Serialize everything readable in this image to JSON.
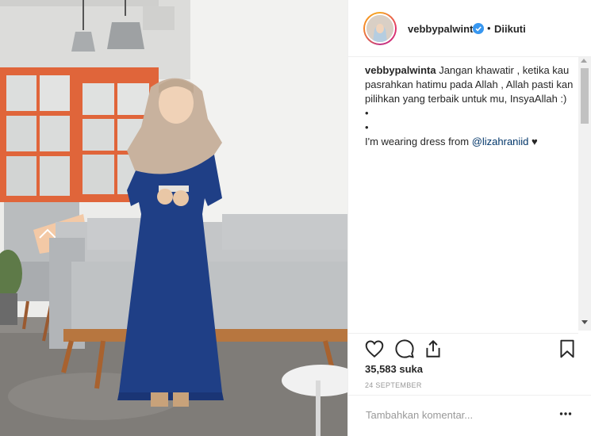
{
  "post": {
    "username": "vebbypalwinta",
    "verified": true,
    "follow_dot": "•",
    "follow_status": "Diikuti",
    "caption": {
      "username": "vebbypalwinta",
      "text": "Jangan khawatir , ketika kau pasrahkan hatimu pada Allah , Allah pasti kan pilihkan yang terbaik untuk mu, InsyaAllah :)",
      "dot1": "•",
      "dot2": "•",
      "wearing_prefix": "I'm wearing dress from ",
      "mention": "@lizahraniid",
      "heart": "♥"
    },
    "likes": "35,583 suka",
    "date": "24 SEPTEMBER",
    "comment_placeholder": "Tambahkan komentar...",
    "icons": {
      "like": "heart-outline-icon",
      "comment": "comment-bubble-icon",
      "share": "share-upload-icon",
      "save": "bookmark-icon",
      "more": "more-options-icon",
      "verified": "verified-badge-icon"
    }
  },
  "colors": {
    "text": "#262626",
    "muted": "#999999",
    "mention": "#003569",
    "verified": "#3897f0",
    "border": "#efefef"
  }
}
